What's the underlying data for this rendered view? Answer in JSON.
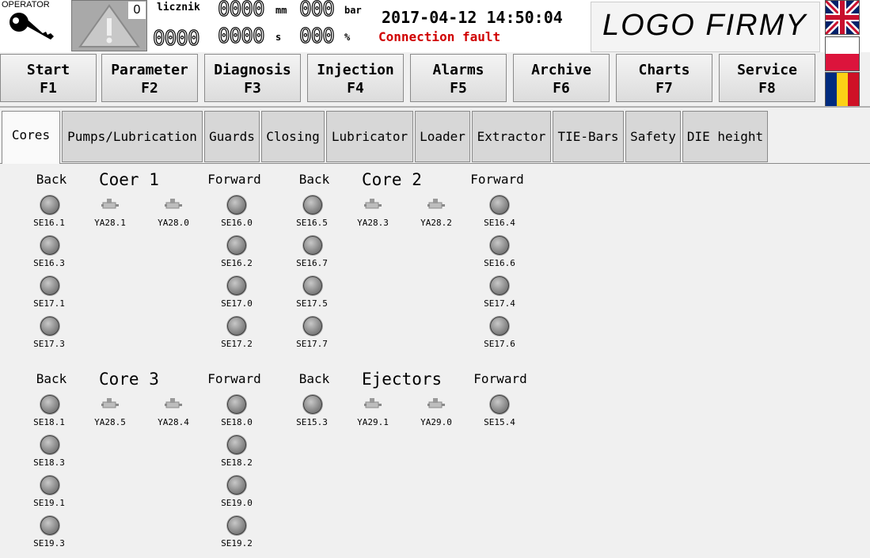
{
  "header": {
    "operator_label": "OPERATOR",
    "warning_count": "0",
    "counter_label": "licznik",
    "counter_mm": "0000",
    "unit_mm": "mm",
    "counter_bar": "000",
    "unit_bar": "bar",
    "counter_left": "0000",
    "counter_s": "0000",
    "unit_s": "s",
    "counter_pct": "000",
    "unit_pct": "%",
    "datetime": "2017-04-12 14:50:04",
    "status": "Connection fault",
    "logo": "LOGO FIRMY"
  },
  "languages": [
    "English",
    "Polski",
    "Română"
  ],
  "fkeys": [
    {
      "label": "Start",
      "key": "F1"
    },
    {
      "label": "Parameter",
      "key": "F2"
    },
    {
      "label": "Diagnosis",
      "key": "F3"
    },
    {
      "label": "Injection",
      "key": "F4"
    },
    {
      "label": "Alarms",
      "key": "F5"
    },
    {
      "label": "Archive",
      "key": "F6"
    },
    {
      "label": "Charts",
      "key": "F7"
    },
    {
      "label": "Service",
      "key": "F8"
    }
  ],
  "tabs": [
    "Cores",
    "Pumps/Lubrication",
    "Guards",
    "Closing",
    "Lubricator",
    "Loader",
    "Extractor",
    "TIE-Bars",
    "Safety",
    "DIE height"
  ],
  "active_tab": "Cores",
  "groups": [
    {
      "title": "Coer 1",
      "back": "Back",
      "forward": "Forward",
      "back_sensors": [
        "SE16.1",
        "SE16.3",
        "SE17.1",
        "SE17.3"
      ],
      "valves": [
        "YA28.1",
        "YA28.0"
      ],
      "forward_sensors": [
        "SE16.0",
        "SE16.2",
        "SE17.0",
        "SE17.2"
      ]
    },
    {
      "title": "Core 2",
      "back": "Back",
      "forward": "Forward",
      "back_sensors": [
        "SE16.5",
        "SE16.7",
        "SE17.5",
        "SE17.7"
      ],
      "valves": [
        "YA28.3",
        "YA28.2"
      ],
      "forward_sensors": [
        "SE16.4",
        "SE16.6",
        "SE17.4",
        "SE17.6"
      ]
    },
    {
      "title": "Core 3",
      "back": "Back",
      "forward": "Forward",
      "back_sensors": [
        "SE18.1",
        "SE18.3",
        "SE19.1",
        "SE19.3"
      ],
      "valves": [
        "YA28.5",
        "YA28.4"
      ],
      "forward_sensors": [
        "SE18.0",
        "SE18.2",
        "SE19.0",
        "SE19.2"
      ]
    },
    {
      "title": "Ejectors",
      "back": "Back",
      "forward": "Forward",
      "back_sensors": [
        "SE15.3"
      ],
      "valves": [
        "YA29.1",
        "YA29.0"
      ],
      "forward_sensors": [
        "SE15.4"
      ]
    }
  ]
}
